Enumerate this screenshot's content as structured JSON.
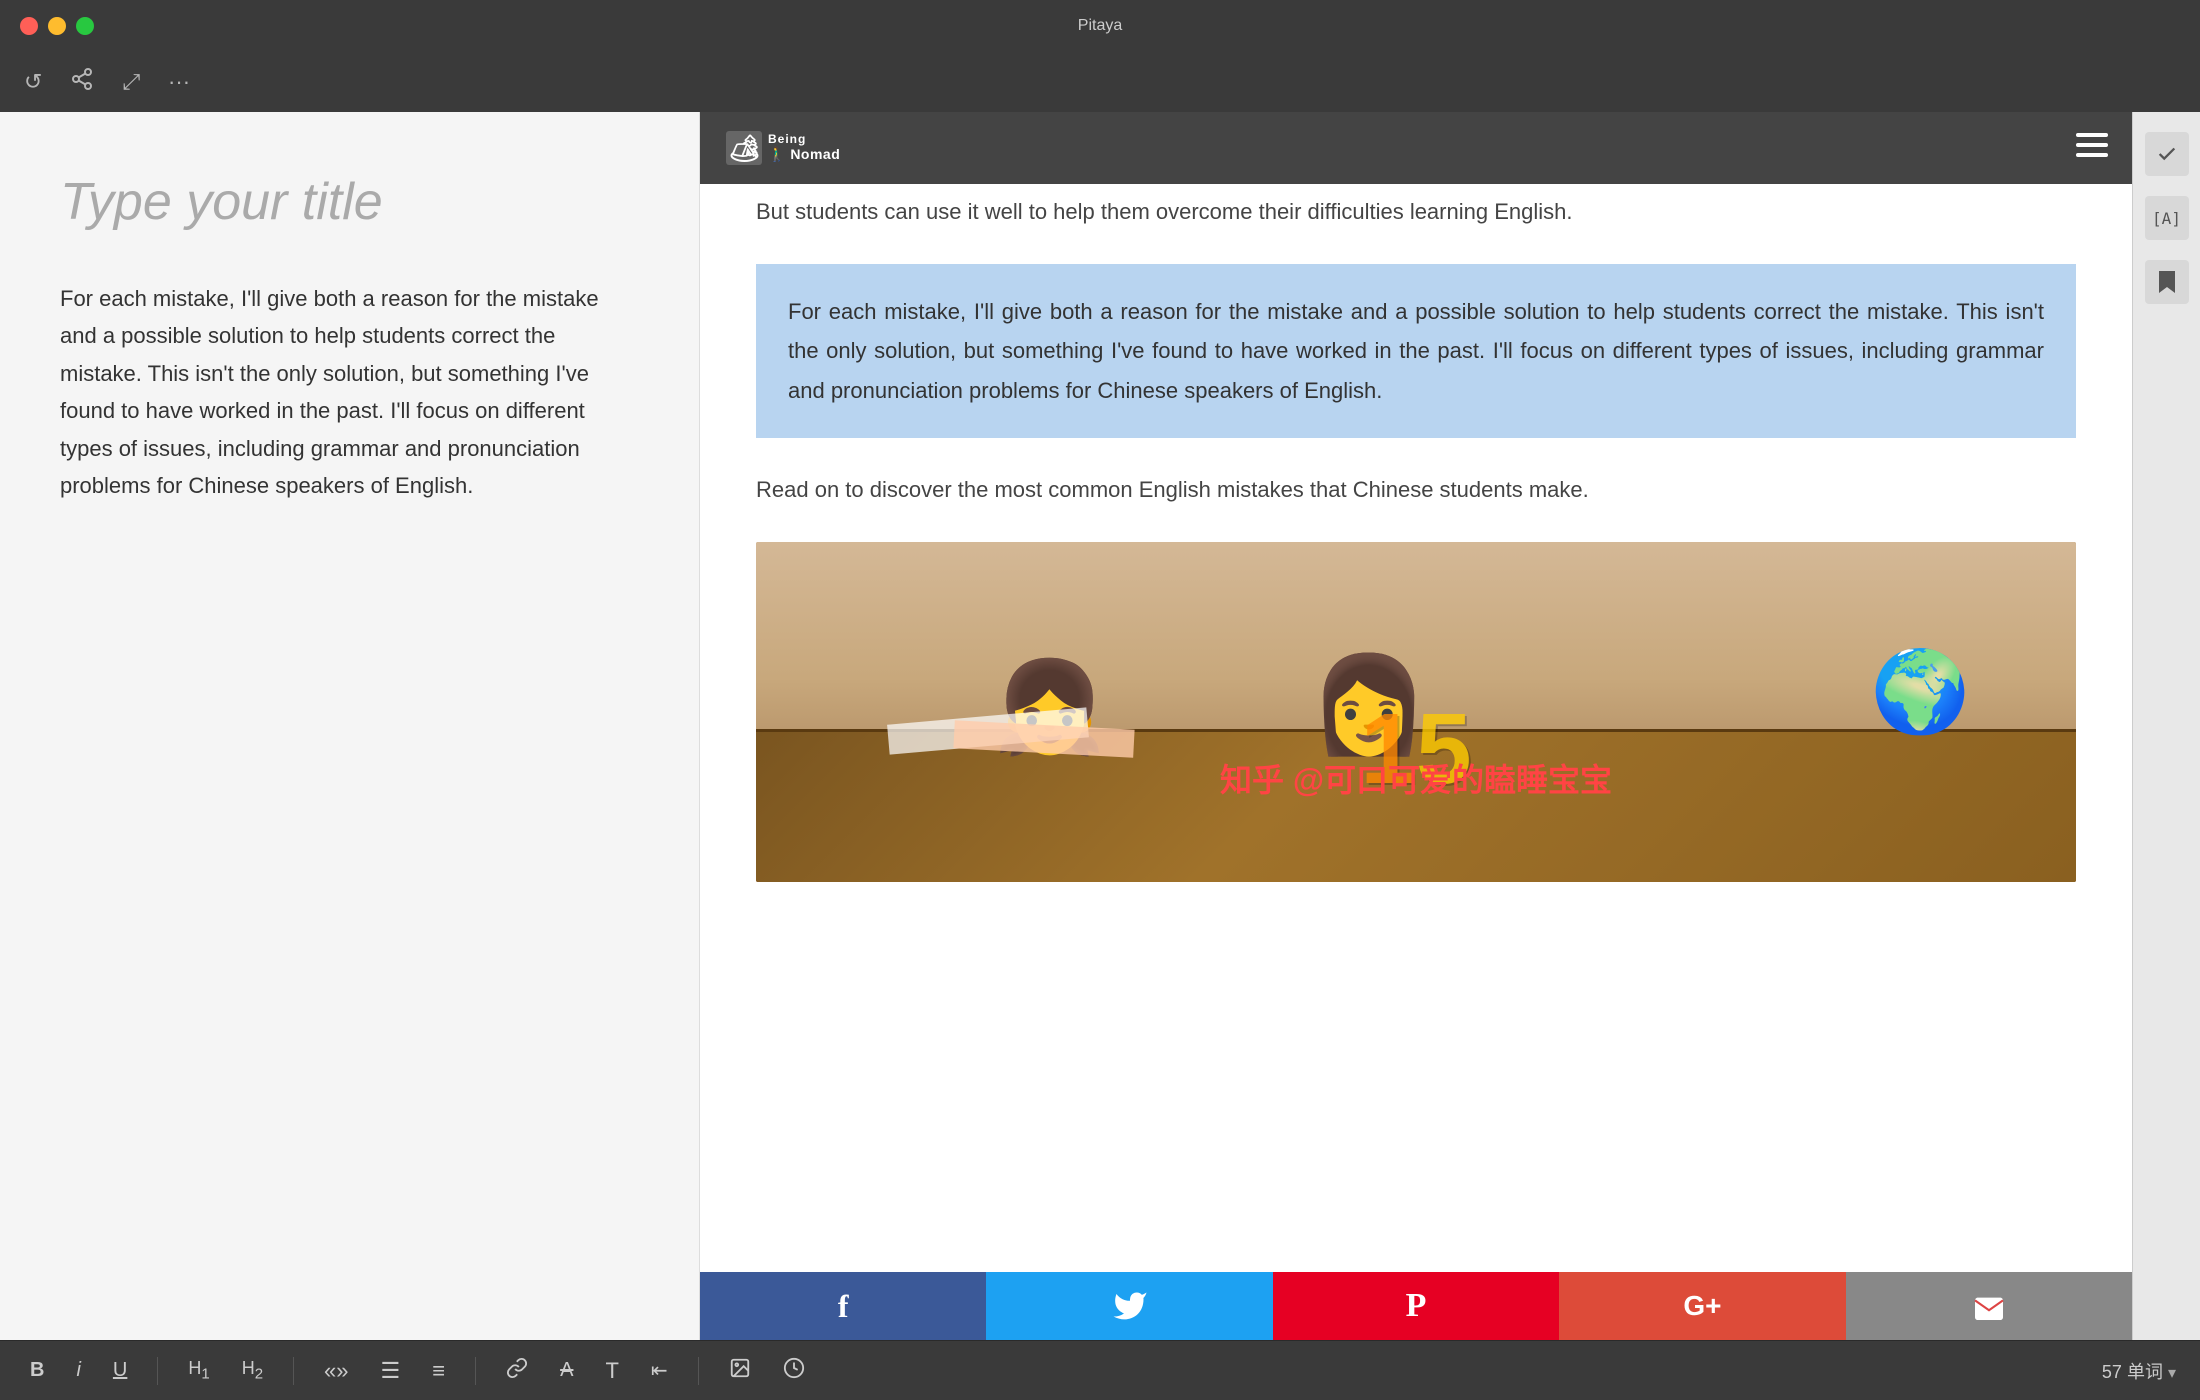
{
  "app": {
    "title": "Pitaya",
    "window_controls": {
      "red": "close",
      "yellow": "minimize",
      "green": "fullscreen"
    }
  },
  "toolbar": {
    "refresh_label": "↺",
    "share_label": "↗",
    "fullscreen_label": "⤢",
    "more_label": "···"
  },
  "editor": {
    "title_placeholder": "Type your title",
    "body_text": "For each mistake, I'll give both a reason for the mistake and a possible solution to help students correct the mistake. This isn't the only solution, but something I've found to have worked in the past. I'll focus on different types of issues, including grammar and pronunciation problems for Chinese speakers of English."
  },
  "browser": {
    "logo_text": "Being Nomad",
    "logo_icon": "🏕",
    "article": {
      "intro_text": "But students can use it well to help them overcome their difficulties learning English.",
      "highlighted_text": "For each mistake, I'll give both a reason for the mistake and a possible solution to help students correct the mistake. This isn't the only solution, but something I've found to have worked in the past. I'll focus on different types of issues, including grammar and pronunciation problems for Chinese speakers of English.",
      "read_on_text": "Read on to discover the most common English mistakes that Chinese students make."
    },
    "watermark": "知乎 @可口可爱的瞌睡宝宝",
    "number_overlay": "15",
    "social": [
      {
        "name": "facebook",
        "icon": "f",
        "label": "Facebook"
      },
      {
        "name": "twitter",
        "icon": "🐦",
        "label": "Twitter"
      },
      {
        "name": "pinterest",
        "icon": "P",
        "label": "Pinterest"
      },
      {
        "name": "gplus",
        "icon": "G+",
        "label": "Google Plus"
      },
      {
        "name": "email",
        "icon": "✉",
        "label": "Email"
      }
    ]
  },
  "bottom_toolbar": {
    "bold": "B",
    "italic": "i",
    "underline": "U",
    "h1": "H₁",
    "h2": "H₂",
    "quote": "«»",
    "list_unordered": "≡",
    "list_ordered": "≡",
    "link": "🔗",
    "strikethrough": "A",
    "text_type": "T",
    "outdent": "⇤",
    "image": "🖼",
    "clock": "🕐",
    "word_count": "57 单词",
    "word_count_arrow": "▾"
  }
}
